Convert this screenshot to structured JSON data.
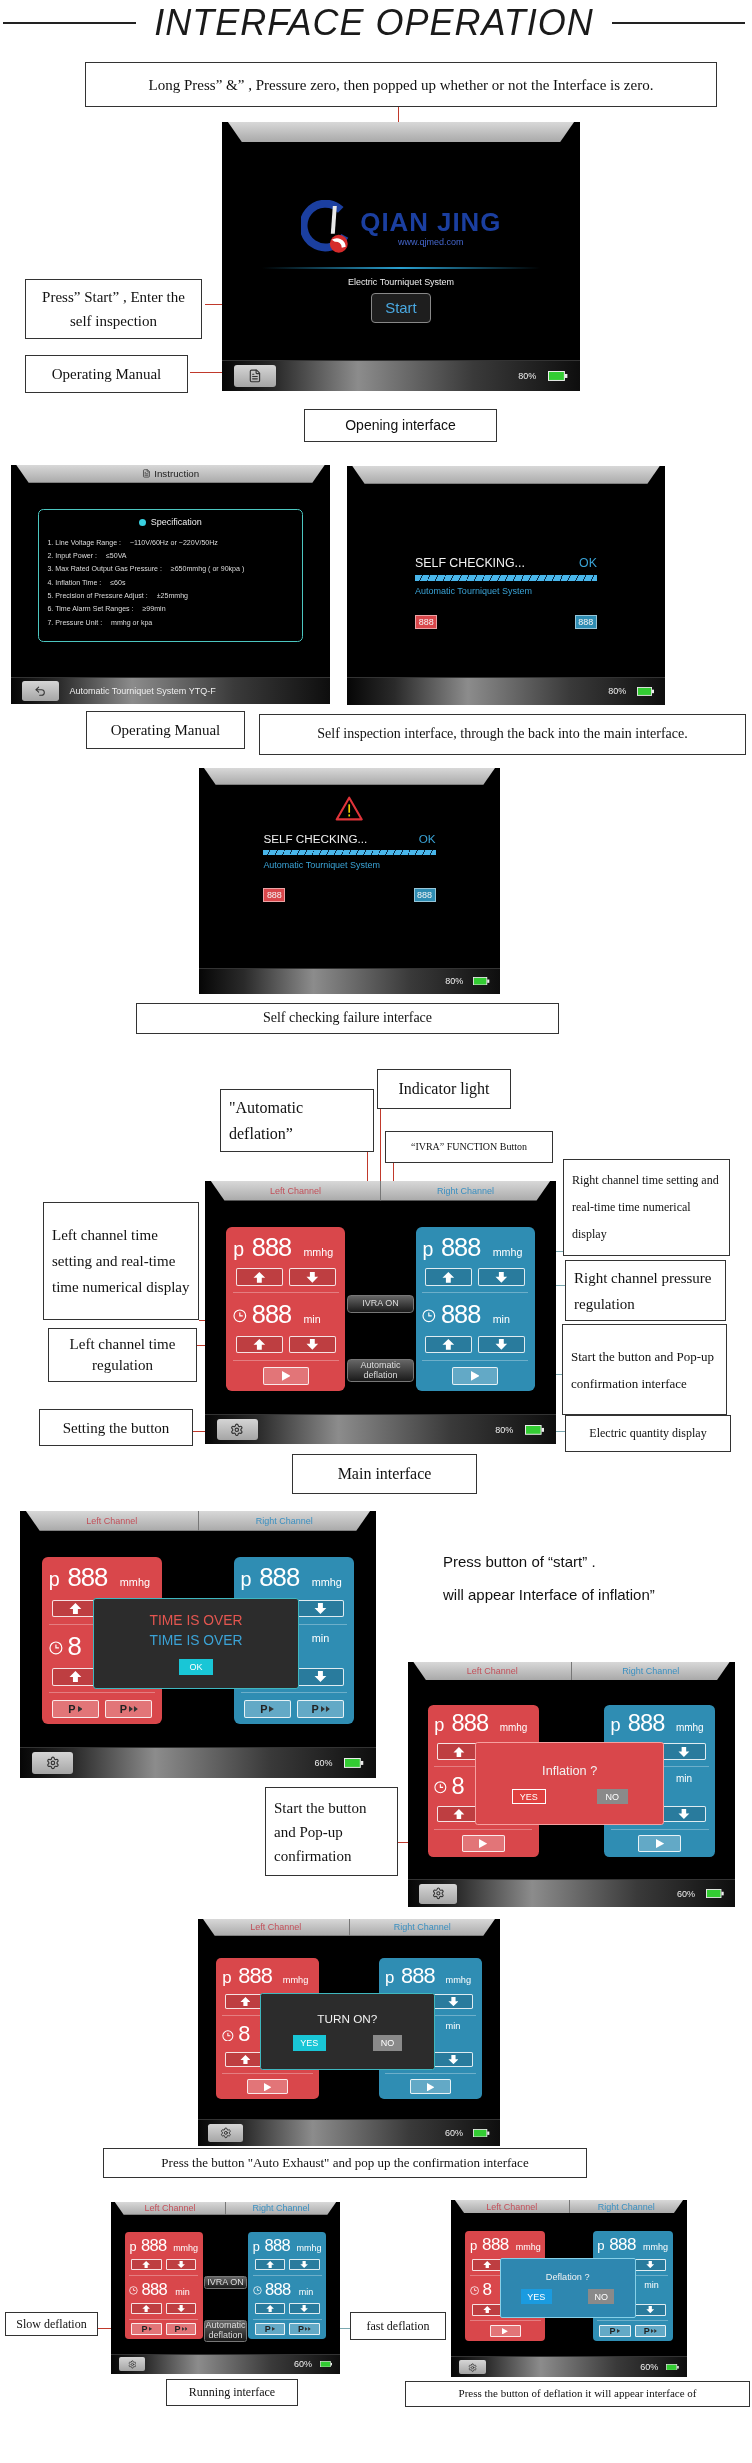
{
  "title": "INTERFACE OPERATION",
  "screens": [
    {
      "kind": "opening",
      "brand": "QIAN JING",
      "website": "www.qjmed.com",
      "system": "Electric Tourniquet System",
      "start": "Start",
      "bottom": {
        "button": {
          "kind": "manual"
        },
        "battery": "80%"
      }
    },
    {
      "kind": "instruction",
      "title": "Instruction",
      "spec_title": "Specification",
      "specs": [
        {
          "label": "1.  Line Voltage Range :",
          "value": "~110V/60Hz  or  ~220V/50Hz"
        },
        {
          "label": "2.  Input Power :",
          "value": "≤50VA"
        },
        {
          "label": "3.  Max Rated Output Gas Pressure :",
          "value": "≥650mmhg ( or 90kpa )"
        },
        {
          "label": "4.  Inflation Time :",
          "value": "≤60s"
        },
        {
          "label": "5.  Precision of Pressure Adjust :",
          "value": "±25mmhg"
        },
        {
          "label": "6.  Time Alarm Set Ranges :",
          "value": "≥99min"
        },
        {
          "label": "7.  Pressure Unit :",
          "value": "mmhg  or  kpa"
        }
      ],
      "bottom": {
        "button": {
          "kind": "back"
        },
        "text": "Automatic Tourniquet System   YTQ-F"
      }
    },
    {
      "kind": "self_check",
      "status": "SELF CHECKING...",
      "result": "OK",
      "level": 1,
      "subtitle": "Automatic Tourniquet System",
      "badges": [
        {
          "text": "888",
          "kind": "left"
        },
        {
          "text": "888",
          "kind": "right"
        }
      ],
      "bottom": {
        "battery": "80%"
      }
    },
    {
      "kind": "self_check_failed",
      "status": "SELF CHECKING...",
      "result": "OK",
      "level": 1,
      "subtitle": "Automatic Tourniquet System",
      "badges": [
        {
          "text": "888",
          "kind": "left"
        },
        {
          "text": "888",
          "kind": "right"
        }
      ],
      "bottom": {
        "battery": "80%"
      }
    },
    {
      "kind": "channels",
      "header": [
        {
          "text": "Left Channel",
          "kind": "left"
        },
        {
          "text": "Right Channel",
          "kind": "right"
        }
      ],
      "panels": [
        {
          "kind": "left",
          "pressure": {
            "symbol": "p",
            "value": "888",
            "unit": "mmhg"
          },
          "pressure_buttons": [
            {
              "kind": "up"
            },
            {
              "kind": "down"
            }
          ],
          "time": {
            "value": "888",
            "unit": "min"
          },
          "time_buttons": [
            {
              "kind": "up"
            },
            {
              "kind": "down"
            }
          ],
          "actions": [
            {
              "kind": "play"
            }
          ]
        },
        {
          "kind": "right",
          "pressure": {
            "symbol": "p",
            "value": "888",
            "unit": "mmhg"
          },
          "pressure_buttons": [
            {
              "kind": "up"
            },
            {
              "kind": "down"
            }
          ],
          "time": {
            "value": "888",
            "unit": "min"
          },
          "time_buttons": [
            {
              "kind": "up"
            },
            {
              "kind": "down"
            }
          ],
          "actions": [
            {
              "kind": "play"
            }
          ]
        }
      ],
      "middle_buttons": [
        {
          "label": "IVRA ON"
        },
        {
          "label": "Automatic deflation"
        }
      ],
      "bottom": {
        "button": {
          "kind": "settings"
        },
        "battery": "80%"
      }
    },
    {
      "kind": "channels",
      "header": [
        {
          "text": "Left Channel",
          "kind": "left"
        },
        {
          "text": "Right Channel",
          "kind": "right"
        }
      ],
      "panels": [
        {
          "kind": "left",
          "pressure": {
            "symbol": "p",
            "value": "888",
            "unit": "mmhg"
          },
          "pressure_buttons": [
            {
              "kind": "up"
            }
          ],
          "time": {
            "value": "8"
          },
          "time_buttons": [
            {
              "kind": "up"
            }
          ],
          "actions": [
            {
              "kind": "slow",
              "label": "P"
            },
            {
              "kind": "fast",
              "label": "P"
            }
          ]
        },
        {
          "kind": "right",
          "pressure": {
            "symbol": "p",
            "value": "888",
            "unit": "mmhg"
          },
          "pressure_buttons": [
            {
              "kind": "down"
            }
          ],
          "time": {
            "unit": "min"
          },
          "time_buttons": [
            {
              "kind": "down"
            }
          ],
          "actions": [
            {
              "kind": "slow",
              "label": "P"
            },
            {
              "kind": "fast",
              "label": "P"
            }
          ]
        }
      ],
      "dialog": {
        "kind": "dark",
        "lines": [
          {
            "text": "TIME IS OVER",
            "kind": "left"
          },
          {
            "text": "TIME IS OVER",
            "kind": "right"
          }
        ],
        "buttons": [
          {
            "label": "OK",
            "kind": "accent"
          }
        ]
      },
      "bottom": {
        "button": {
          "kind": "settings"
        },
        "battery": "60%"
      }
    },
    {
      "kind": "channels",
      "header": [
        {
          "text": "Left Channel",
          "kind": "left"
        },
        {
          "text": "Right Channel",
          "kind": "right"
        }
      ],
      "panels": [
        {
          "kind": "left",
          "pressure": {
            "symbol": "p",
            "value": "888",
            "unit": "mmhg"
          },
          "pressure_buttons": [
            {
              "kind": "up"
            }
          ],
          "time": {
            "value": "8"
          },
          "time_buttons": [
            {
              "kind": "up"
            }
          ],
          "actions": [
            {
              "kind": "play"
            }
          ]
        },
        {
          "kind": "right",
          "pressure": {
            "symbol": "p",
            "value": "888",
            "unit": "mmhg"
          },
          "pressure_buttons": [
            {
              "kind": "down"
            }
          ],
          "time": {
            "unit": "min"
          },
          "time_buttons": [
            {
              "kind": "down"
            }
          ],
          "actions": [
            {
              "kind": "play"
            }
          ]
        }
      ],
      "dialog": {
        "kind": "red",
        "lines": [
          {
            "text": "Inflation ?",
            "kind": "plain"
          }
        ],
        "buttons": [
          {
            "label": "YES",
            "kind": "danger"
          },
          {
            "label": "NO",
            "kind": "muted"
          }
        ]
      },
      "bottom": {
        "button": {
          "kind": "settings"
        },
        "battery": "60%"
      }
    },
    {
      "kind": "channels",
      "header": [
        {
          "text": "Left Channel",
          "kind": "left"
        },
        {
          "text": "Right Channel",
          "kind": "right"
        }
      ],
      "panels": [
        {
          "kind": "left",
          "pressure": {
            "symbol": "p",
            "value": "888",
            "unit": "mmhg"
          },
          "pressure_buttons": [
            {
              "kind": "up"
            }
          ],
          "time": {
            "value": "8"
          },
          "time_buttons": [
            {
              "kind": "up"
            }
          ],
          "actions": [
            {
              "kind": "play"
            }
          ]
        },
        {
          "kind": "right",
          "pressure": {
            "symbol": "p",
            "value": "888",
            "unit": "mmhg"
          },
          "pressure_buttons": [
            {
              "kind": "down"
            }
          ],
          "time": {
            "unit": "min"
          },
          "time_buttons": [
            {
              "kind": "down"
            }
          ],
          "actions": [
            {
              "kind": "play"
            }
          ]
        }
      ],
      "dialog": {
        "kind": "dark",
        "lines": [
          {
            "text": "TURN ON?",
            "kind": "plain"
          }
        ],
        "buttons": [
          {
            "label": "YES",
            "kind": "accent"
          },
          {
            "label": "NO",
            "kind": "muted"
          }
        ]
      },
      "bottom": {
        "button": {
          "kind": "settings"
        },
        "battery": "60%"
      }
    },
    {
      "kind": "channels",
      "header": [
        {
          "text": "Left Channel",
          "kind": "left"
        },
        {
          "text": "Right Channel",
          "kind": "right"
        }
      ],
      "panels": [
        {
          "kind": "left",
          "pressure": {
            "symbol": "p",
            "value": "888",
            "unit": "mmhg"
          },
          "pressure_buttons": [
            {
              "kind": "up"
            },
            {
              "kind": "down"
            }
          ],
          "time": {
            "value": "888",
            "unit": "min"
          },
          "time_buttons": [
            {
              "kind": "up"
            },
            {
              "kind": "down"
            }
          ],
          "actions": [
            {
              "kind": "slow",
              "label": "P"
            },
            {
              "kind": "fast",
              "label": "P"
            }
          ]
        },
        {
          "kind": "right",
          "pressure": {
            "symbol": "p",
            "value": "888",
            "unit": "mmhg"
          },
          "pressure_buttons": [
            {
              "kind": "up"
            },
            {
              "kind": "down"
            }
          ],
          "time": {
            "value": "888",
            "unit": "min"
          },
          "time_buttons": [
            {
              "kind": "up"
            },
            {
              "kind": "down"
            }
          ],
          "actions": [
            {
              "kind": "slow",
              "label": "P"
            },
            {
              "kind": "fast",
              "label": "P"
            }
          ]
        }
      ],
      "middle_buttons": [
        {
          "label": "IVRA ON"
        },
        {
          "label": "Automatic deflation"
        }
      ],
      "bottom": {
        "button": {
          "kind": "settings"
        },
        "battery": "60%"
      }
    },
    {
      "kind": "channels",
      "header": [
        {
          "text": "Left Channel",
          "kind": "left"
        },
        {
          "text": "Right Channel",
          "kind": "right"
        }
      ],
      "panels": [
        {
          "kind": "left",
          "pressure": {
            "symbol": "p",
            "value": "888",
            "unit": "mmhg"
          },
          "pressure_buttons": [
            {
              "kind": "up"
            }
          ],
          "time": {
            "value": "8"
          },
          "time_buttons": [
            {
              "kind": "up"
            }
          ],
          "actions": [
            {
              "kind": "play"
            }
          ]
        },
        {
          "kind": "right",
          "pressure": {
            "symbol": "p",
            "value": "888",
            "unit": "mmhg"
          },
          "pressure_buttons": [
            {
              "kind": "down"
            }
          ],
          "time": {
            "unit": "min"
          },
          "time_buttons": [
            {
              "kind": "down"
            }
          ],
          "actions": [
            {
              "kind": "slow",
              "label": "P"
            },
            {
              "kind": "fast",
              "label": "P"
            }
          ]
        }
      ],
      "dialog": {
        "kind": "blue",
        "lines": [
          {
            "text": "Deflation ?",
            "kind": "plain"
          }
        ],
        "buttons": [
          {
            "label": "YES",
            "kind": "info"
          },
          {
            "label": "NO",
            "kind": "muted"
          }
        ]
      },
      "bottom": {
        "button": {
          "kind": "settings"
        },
        "battery": "60%"
      }
    }
  ],
  "labels": [
    {
      "text": "Long Press” &” , Pressure zero, then popped up whether or not the Interface is zero."
    },
    {
      "text": "Press” Start” , Enter the self inspection"
    },
    {
      "text": "Operating Manual"
    },
    {
      "text": "Opening interface"
    },
    {
      "text": "Operating Manual"
    },
    {
      "text": "Self inspection interface, through the back into the main interface."
    },
    {
      "text": "Self checking failure interface"
    },
    {
      "text": "\"Automatic deflation”"
    },
    {
      "text": "Indicator light"
    },
    {
      "text": "“IVRA” FUNCTION Button"
    },
    {
      "text": "Right channel time setting and real-time time numerical display"
    },
    {
      "text": "Left channel time setting and real-time time numerical display"
    },
    {
      "text": "Right channel pressure regulation"
    },
    {
      "text": "Left channel time regulation"
    },
    {
      "text": "Start the button and Pop-up confirmation interface"
    },
    {
      "text": "Setting the button"
    },
    {
      "text": "Electric quantity display"
    },
    {
      "text": "Main interface"
    },
    {
      "text": "Start the button and Pop-up confirmation"
    },
    {
      "text": "Press the button \"Auto Exhaust\" and pop up the confirmation interface"
    },
    {
      "text": "Slow deflation"
    },
    {
      "text": "fast deflation"
    },
    {
      "text": "Running interface"
    },
    {
      "text": "Press the button of deflation it will appear interface of"
    }
  ],
  "notes": [
    "Press button of   “start” .",
    "will appear Interface of inflation”"
  ]
}
